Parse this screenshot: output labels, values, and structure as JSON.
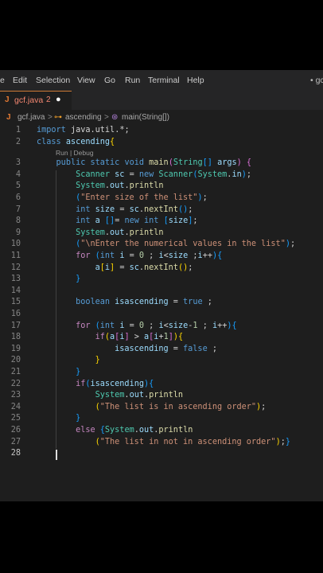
{
  "menu": {
    "items": [
      "e",
      "Edit",
      "Selection",
      "View",
      "Go",
      "Run",
      "Terminal",
      "Help"
    ],
    "right_indicator": "• gc"
  },
  "tab": {
    "icon": "J",
    "filename": "gcf.java",
    "problem_count": "2",
    "modified_dot": "●"
  },
  "breadcrumb": {
    "file_icon": "J",
    "file": "gcf.java",
    "sep1": ">",
    "class_icon": "⊶",
    "class": "ascending",
    "sep2": ">",
    "method_icon": "⊛",
    "method": "main(String[])"
  },
  "codelens": "Run | Debug",
  "editor": {
    "lines": [
      "import java.util.*;",
      "class ascending{",
      "    public static void main(String[] args) {",
      "        Scanner sc = new Scanner(System.in);",
      "        System.out.println",
      "        (\"Enter size of the list\");",
      "        int size = sc.nextInt();",
      "        int a []= new int [size];",
      "        System.out.println",
      "        (\"\\nEnter the numerical values in the list\");",
      "        for (int i = 0 ; i<size ;i++){",
      "            a[i] = sc.nextInt();",
      "        }",
      "",
      "        boolean isascending = true ;",
      "",
      "        for (int i = 0 ; i<size-1 ; i++){",
      "            if(a[i] > a[i+1]){",
      "                isascending = false ;",
      "            }",
      "        }",
      "        if(isascending){",
      "            System.out.println",
      "            (\"The list is in ascending order\");",
      "        }",
      "        else {System.out.println",
      "            (\"The list in not in ascending order\");}",
      ""
    ],
    "current_line": 28
  },
  "colors": {
    "keyword": "#569cd6",
    "control": "#c586c0",
    "type": "#4ec9b0",
    "variable": "#9cdcfe",
    "function": "#dcdcaa",
    "string": "#ce9178",
    "number": "#b5cea8",
    "text": "#d4d4d4",
    "bracket_gold": "#ffd700",
    "bracket_purple": "#da70d6",
    "bracket_blue": "#179fff",
    "error_underline": "#f14c4c"
  }
}
